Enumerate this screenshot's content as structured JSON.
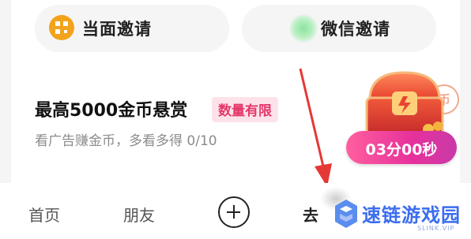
{
  "invite": {
    "face_label": "当面邀请",
    "face_icon": "qr-code-icon",
    "wechat_label": "微信邀请",
    "wechat_icon": "wechat-icon"
  },
  "task": {
    "title": "最高5000金币悬赏",
    "badge": "数量有限",
    "description": "看广告赚金币，多看多得 0/10"
  },
  "reward": {
    "icon": "treasure-chest-icon",
    "timer": "03分00秒"
  },
  "tabbar": {
    "home": "首页",
    "friends": "朋友",
    "add_icon": "plus-circle-icon",
    "go": "去"
  },
  "watermark": {
    "text": "速链游戏园",
    "sub": "SLINK.VIP"
  },
  "colors": {
    "accent_pink": "#e4386a",
    "timer_gradient_start": "#ff5f9e",
    "timer_gradient_end": "#c93aa8",
    "qr_icon": "#f3a21c",
    "annotation_arrow": "#e53935"
  }
}
